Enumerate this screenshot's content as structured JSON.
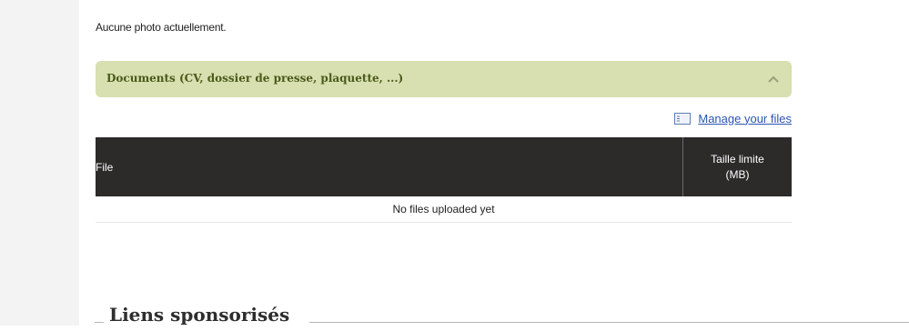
{
  "photos": {
    "empty_message": "Aucune photo actuellement."
  },
  "documents": {
    "section_title": "Documents (CV, dossier de presse, plaquette, ...)",
    "collapse_icon": "chevron-up-icon",
    "manage_icon": "file-list-icon",
    "manage_link": "Manage your files",
    "table": {
      "headers": [
        "File",
        "Taille limite (MB)"
      ],
      "empty_message": "No files uploaded yet"
    }
  },
  "sponsored": {
    "title": "Liens sponsorisés"
  },
  "colors": {
    "accordion_bg": "#d8dfb0",
    "accordion_text": "#4a5a1a",
    "table_header_bg": "#2d2a2a",
    "link": "#2a55b0"
  }
}
